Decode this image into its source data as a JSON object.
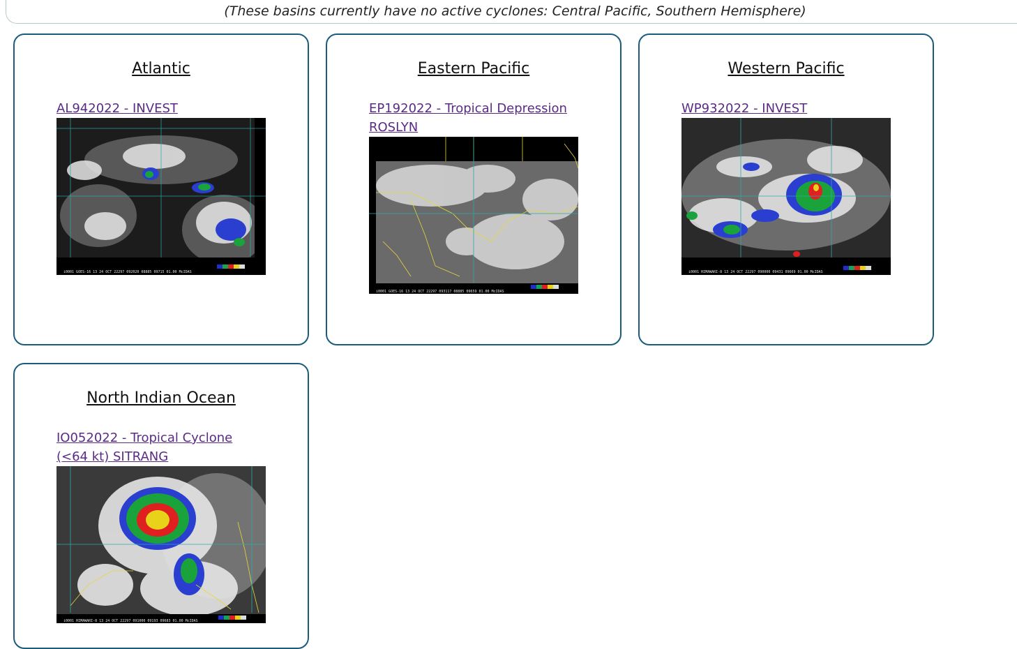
{
  "notice": "(These basins currently have no active cyclones: Central Pacific, Southern Hemisphere)",
  "basins": [
    {
      "title": "Atlantic",
      "storm_link": "AL942022 - INVEST",
      "image_alt": "Atlantic satellite image",
      "caption": "i0001 GOES-16  13 24 OCT 22297 092020 08885 09715 01.00  McIDAS"
    },
    {
      "title": "Eastern Pacific",
      "storm_link": "EP192022 - Tropical Depression ROSLYN",
      "image_alt": "Eastern Pacific satellite image",
      "caption": "i0001 GOES-16  13 24 OCT 22297 093117 08885 09659 01.00  McIDAS"
    },
    {
      "title": "Western Pacific",
      "storm_link": "WP932022 - INVEST",
      "image_alt": "Western Pacific satellite image",
      "caption": "i0001 HIMAWARI-8 13 24 OCT 22297 090000 09431 09669 01.00  McIDAS"
    },
    {
      "title": "North Indian Ocean",
      "storm_link": "IO052022 - Tropical Cyclone (<64 kt) SITRANG",
      "image_alt": "North Indian Ocean satellite image",
      "caption": "i0001 HIMAWARI-8 13 24 OCT 22297 091000 09193 09683 01.00  McIDAS"
    }
  ]
}
